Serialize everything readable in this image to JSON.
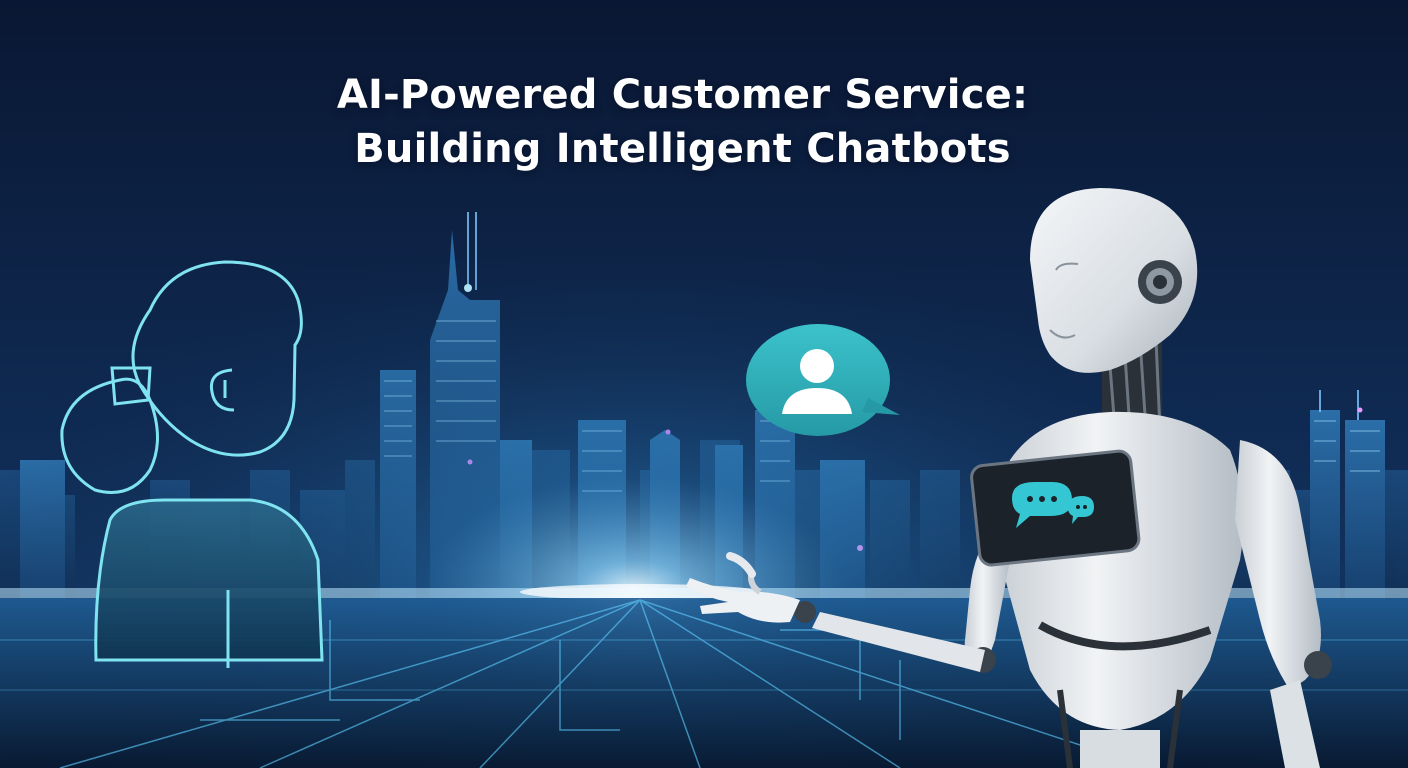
{
  "title": {
    "line1": "AI-Powered Customer Service:",
    "line2": "Building Intelligent Chatbots"
  },
  "colors": {
    "background_dark": "#081429",
    "background_mid": "#0f2f57",
    "horizon_glow": "#bfe9ff",
    "city_lights": "#8fd3ff",
    "outline_cyan": "#7fe3f0",
    "bubble_teal": "#2fb3bd",
    "robot_white": "#e4e8ec",
    "robot_joint_dark": "#2b3138",
    "screen_dark": "#1b2229",
    "screen_icon_teal": "#35c6d3",
    "title_text": "#ffffff"
  },
  "icons": {
    "person_outline": "person-outline-icon",
    "speech_bubble": "speech-bubble-user-icon",
    "chat_bubbles": "chat-bubbles-icon",
    "robot": "robot-icon"
  }
}
